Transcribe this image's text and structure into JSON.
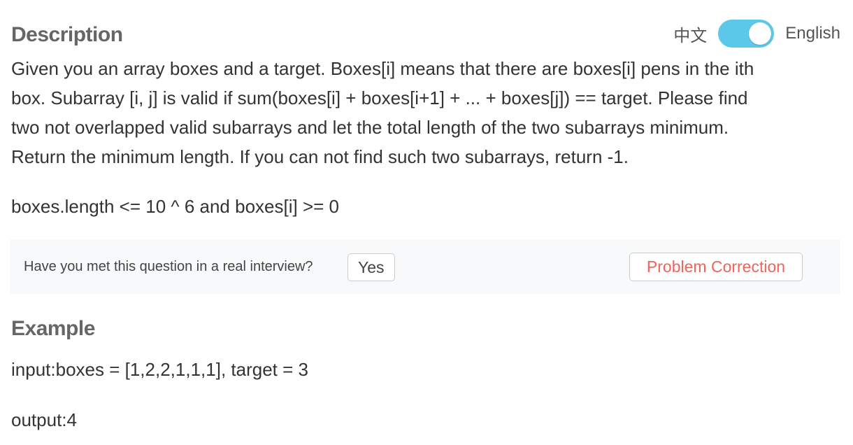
{
  "description": {
    "title": "Description",
    "lines": [
      "Given you an array boxes and a target. Boxes[i] means that there are boxes[i] pens in the ith",
      "box. Subarray [i, j] is valid if sum(boxes[i] + boxes[i+1] + ... + boxes[j]) == target. Please find",
      "two not overlapped valid subarrays and let the total length of the two subarrays minimum.",
      "Return the minimum length. If you can not find such two subarrays, return -1."
    ],
    "constraint": "boxes.length <= 10 ^ 6 and boxes[i] >= 0"
  },
  "language_switch": {
    "zh_label": "中文",
    "en_label": "English",
    "active": "English",
    "toggle_color": "#5bc8ea"
  },
  "feedback": {
    "question": "Have you met this question in a real interview?",
    "yes_label": "Yes",
    "correction_label": "Problem Correction"
  },
  "example": {
    "title": "Example",
    "input": "input:boxes = [1,2,2,1,1,1], target = 3",
    "output": "output:4"
  }
}
